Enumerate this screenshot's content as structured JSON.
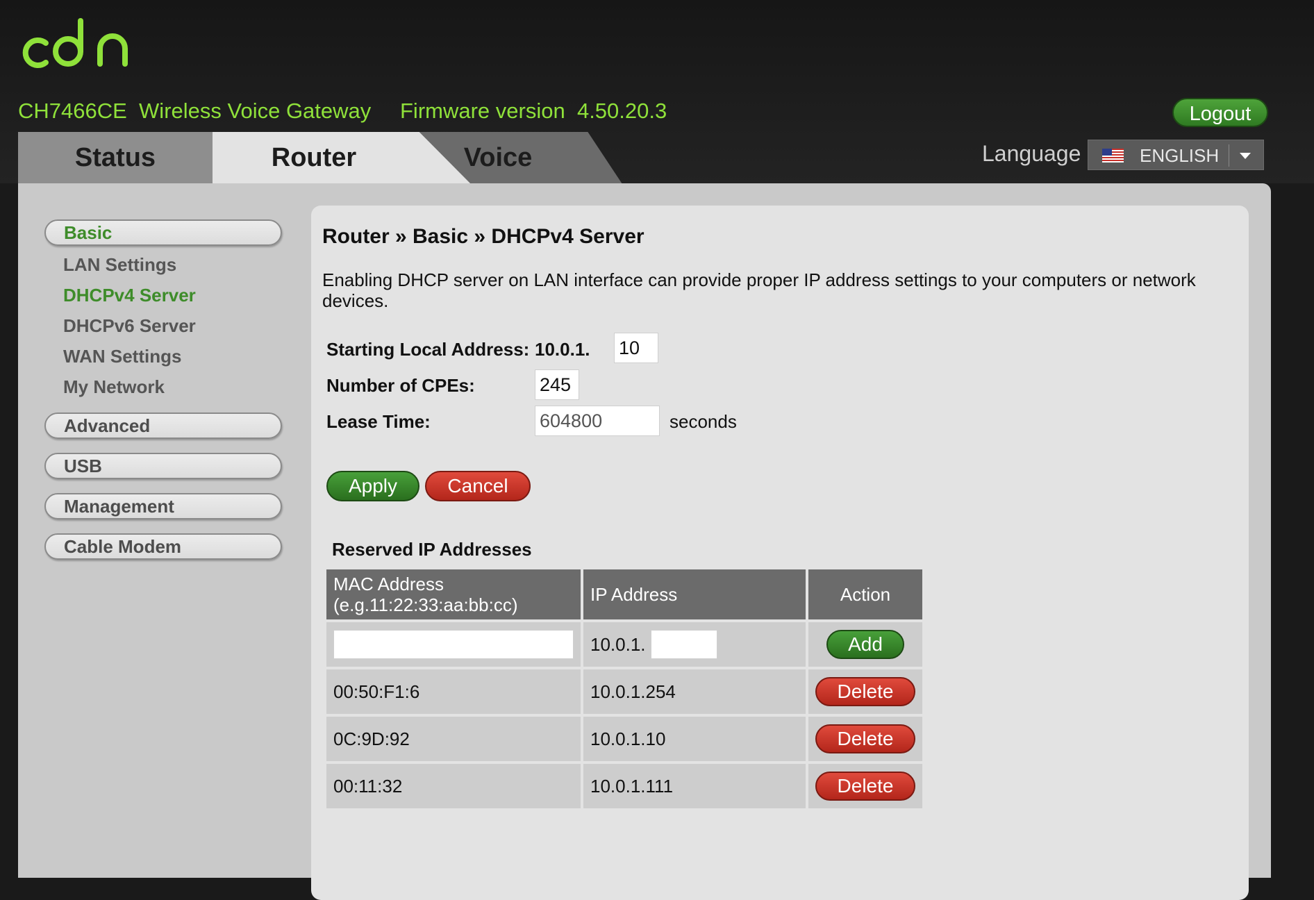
{
  "header": {
    "logo_alt": "cbn",
    "model": "CH7466CE",
    "product": "Wireless Voice Gateway",
    "firmware_label": "Firmware version",
    "firmware_version": "4.50.20.3",
    "logout_label": "Logout",
    "language_label": "Language",
    "language_value": "ENGLISH",
    "flag_icon": "us-flag-icon"
  },
  "tabs": [
    {
      "label": "Status",
      "active": false
    },
    {
      "label": "Router",
      "active": true
    },
    {
      "label": "Voice",
      "active": false
    }
  ],
  "sidebar": {
    "groups": [
      {
        "label": "Basic",
        "active": true
      },
      {
        "label": "Advanced",
        "active": false
      },
      {
        "label": "USB",
        "active": false
      },
      {
        "label": "Management",
        "active": false
      },
      {
        "label": "Cable Modem",
        "active": false
      }
    ],
    "basic_items": [
      {
        "label": "LAN Settings",
        "active": false
      },
      {
        "label": "DHCPv4 Server",
        "active": true
      },
      {
        "label": "DHCPv6 Server",
        "active": false
      },
      {
        "label": "WAN Settings",
        "active": false
      },
      {
        "label": "My Network",
        "active": false
      }
    ]
  },
  "content": {
    "breadcrumb": "Router » Basic » DHCPv4 Server",
    "description": "Enabling DHCP server on LAN interface can provide proper IP address settings to your computers or network devices.",
    "form": {
      "start_label": "Starting Local Address:",
      "start_prefix": "10.0.1.",
      "start_value": "10",
      "cpe_label": "Number of CPEs:",
      "cpe_value": "245",
      "lease_label": "Lease Time:",
      "lease_value": "604800",
      "lease_unit": "seconds"
    },
    "apply_label": "Apply",
    "cancel_label": "Cancel",
    "reserved": {
      "title": "Reserved IP Addresses",
      "headers": {
        "mac": "MAC Address",
        "mac_hint": "(e.g.11:22:33:aa:bb:cc)",
        "ip": "IP Address",
        "action": "Action"
      },
      "new_row": {
        "mac_value": "",
        "ip_prefix": "10.0.1.",
        "ip_value": "",
        "add_label": "Add"
      },
      "rows": [
        {
          "mac": "00:50:F1:6",
          "ip": "10.0.1.254",
          "action": "Delete"
        },
        {
          "mac": "0C:9D:92",
          "ip": "10.0.1.10",
          "action": "Delete"
        },
        {
          "mac": "00:11:32",
          "ip": "10.0.1.111",
          "action": "Delete"
        }
      ]
    }
  },
  "colors": {
    "brand_green": "#8fe13a",
    "active_green": "#3e8c2a",
    "button_green": "#2f7a22",
    "button_red": "#c0302a"
  }
}
